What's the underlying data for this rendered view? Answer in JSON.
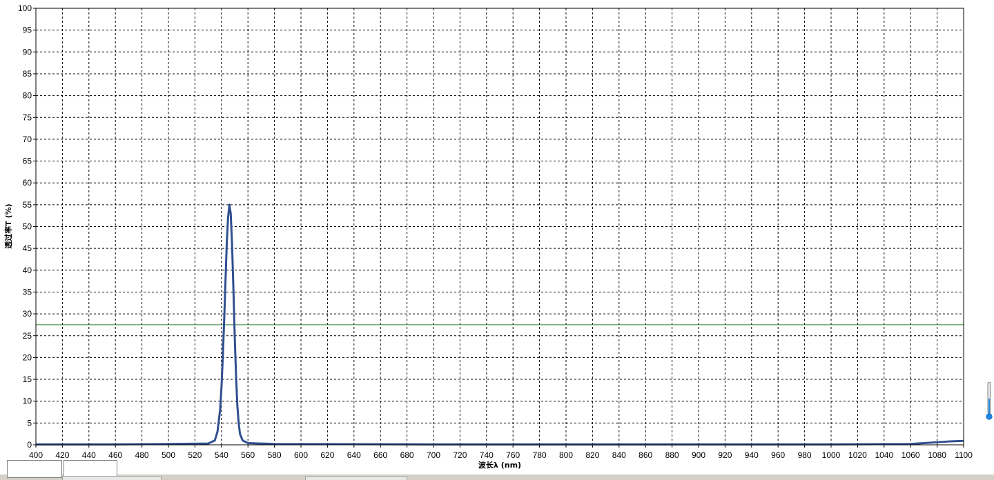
{
  "chart_data": {
    "type": "line",
    "title": "",
    "xlabel": "波长λ (nm)",
    "ylabel": "透过率T (%)",
    "xlim": [
      400,
      1100
    ],
    "ylim": [
      0,
      100
    ],
    "x_ticks": [
      400,
      420,
      440,
      460,
      480,
      500,
      520,
      540,
      560,
      580,
      600,
      620,
      640,
      660,
      680,
      700,
      720,
      740,
      760,
      780,
      800,
      820,
      840,
      860,
      880,
      900,
      920,
      940,
      960,
      980,
      1000,
      1020,
      1040,
      1060,
      1080,
      1100
    ],
    "y_ticks": [
      0,
      5,
      10,
      15,
      20,
      25,
      30,
      35,
      40,
      45,
      50,
      55,
      60,
      65,
      70,
      75,
      80,
      85,
      90,
      95,
      100
    ],
    "grid": true,
    "grid_style": "dashed",
    "series": [
      {
        "color": "#2f4f8f",
        "points": [
          [
            400,
            0.1
          ],
          [
            460,
            0.1
          ],
          [
            500,
            0.2
          ],
          [
            530,
            0.3
          ],
          [
            535,
            1
          ],
          [
            537,
            3
          ],
          [
            539,
            8
          ],
          [
            540,
            13
          ],
          [
            541,
            20
          ],
          [
            542,
            28
          ],
          [
            543,
            37
          ],
          [
            544,
            46
          ],
          [
            545,
            52
          ],
          [
            546,
            55
          ],
          [
            547,
            53
          ],
          [
            548,
            46
          ],
          [
            549,
            36
          ],
          [
            550,
            25
          ],
          [
            551,
            16
          ],
          [
            552,
            9
          ],
          [
            553,
            5
          ],
          [
            554,
            2.5
          ],
          [
            556,
            1
          ],
          [
            560,
            0.4
          ],
          [
            580,
            0.2
          ],
          [
            700,
            0.1
          ],
          [
            900,
            0.1
          ],
          [
            1000,
            0.1
          ],
          [
            1060,
            0.2
          ],
          [
            1070,
            0.4
          ],
          [
            1080,
            0.6
          ],
          [
            1090,
            0.8
          ],
          [
            1100,
            0.9
          ]
        ]
      }
    ],
    "reference_line": {
      "y": 27.5,
      "color": "#2e7d32"
    }
  }
}
